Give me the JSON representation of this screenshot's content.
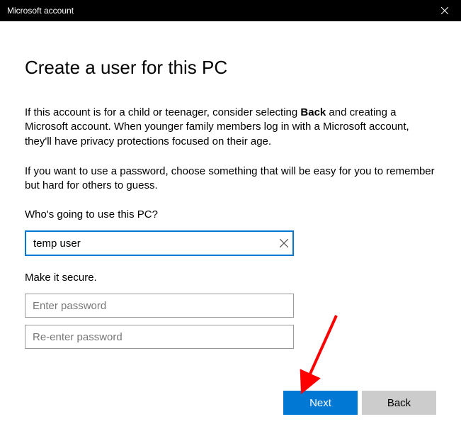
{
  "window": {
    "title": "Microsoft account"
  },
  "page": {
    "title": "Create a user for this PC",
    "para1_a": "If this account is for a child or teenager, consider selecting ",
    "para1_bold": "Back",
    "para1_b": " and creating a Microsoft account. When younger family members log in with a Microsoft account, they'll have privacy protections focused on their age.",
    "para2": "If you want to use a password, choose something that will be easy for you to remember but hard for others to guess."
  },
  "form": {
    "username_label": "Who's going to use this PC?",
    "username_value": "temp user",
    "secure_label": "Make it secure.",
    "password_placeholder": "Enter password",
    "password2_placeholder": "Re-enter password"
  },
  "buttons": {
    "next": "Next",
    "back": "Back"
  }
}
